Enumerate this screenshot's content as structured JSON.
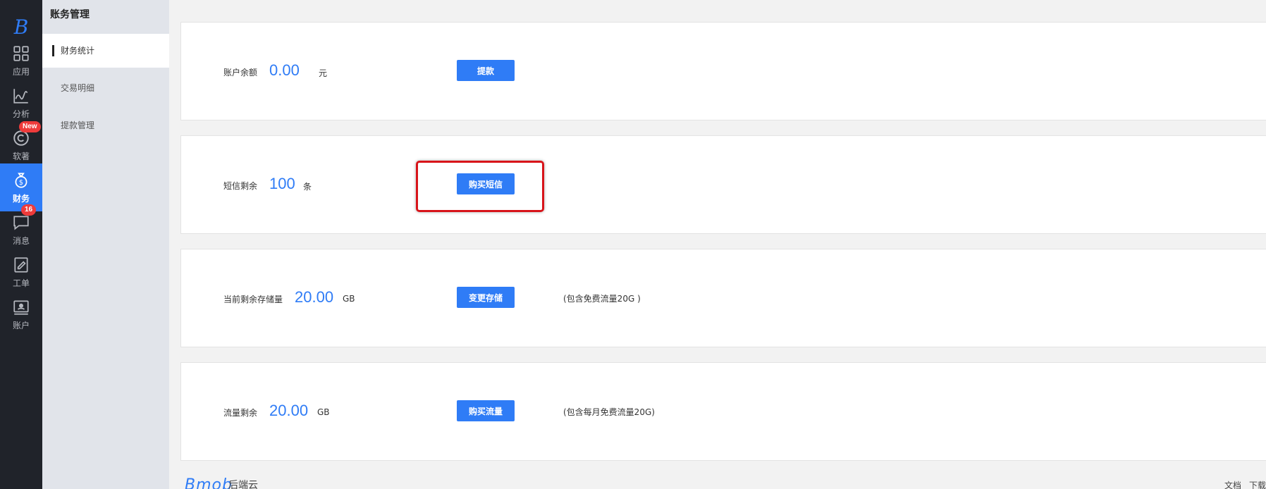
{
  "rail": {
    "logo": "B",
    "items": [
      {
        "label": "应用",
        "icon": "grid-icon"
      },
      {
        "label": "分析",
        "icon": "chart-line-icon"
      },
      {
        "label": "软著",
        "icon": "copyright-icon",
        "badge": "New"
      },
      {
        "label": "财务",
        "icon": "money-bag-icon",
        "active": true
      },
      {
        "label": "消息",
        "icon": "chat-icon",
        "badge": "16"
      },
      {
        "label": "工单",
        "icon": "edit-doc-icon"
      },
      {
        "label": "账户",
        "icon": "account-card-icon"
      }
    ]
  },
  "sidebar": {
    "title": "账务管理",
    "items": [
      {
        "label": "财务统计",
        "active": true
      },
      {
        "label": "交易明细"
      },
      {
        "label": "提款管理"
      }
    ]
  },
  "cards": [
    {
      "label": "账户余额",
      "value": "0.00",
      "unit": "元",
      "button": "提款",
      "note": ""
    },
    {
      "label": "短信剩余",
      "value": "100",
      "unit": "条",
      "button": "购买短信",
      "note": ""
    },
    {
      "label": "当前剩余存储量",
      "value": "20.00",
      "unit": "GB",
      "button": "变更存储",
      "note": "(包含免费流量20G )"
    },
    {
      "label": "流量剩余",
      "value": "20.00",
      "unit": "GB",
      "button": "购买流量",
      "note": "(包含每月免费流量20G)"
    }
  ],
  "footer": {
    "logo": "Bmob",
    "name": "后端云",
    "links": [
      "文档",
      "下载"
    ]
  },
  "colors": {
    "accent": "#2f7cf6",
    "rail_bg": "#20232a",
    "highlight": "#d8141a",
    "badge": "#ee3b3b"
  }
}
